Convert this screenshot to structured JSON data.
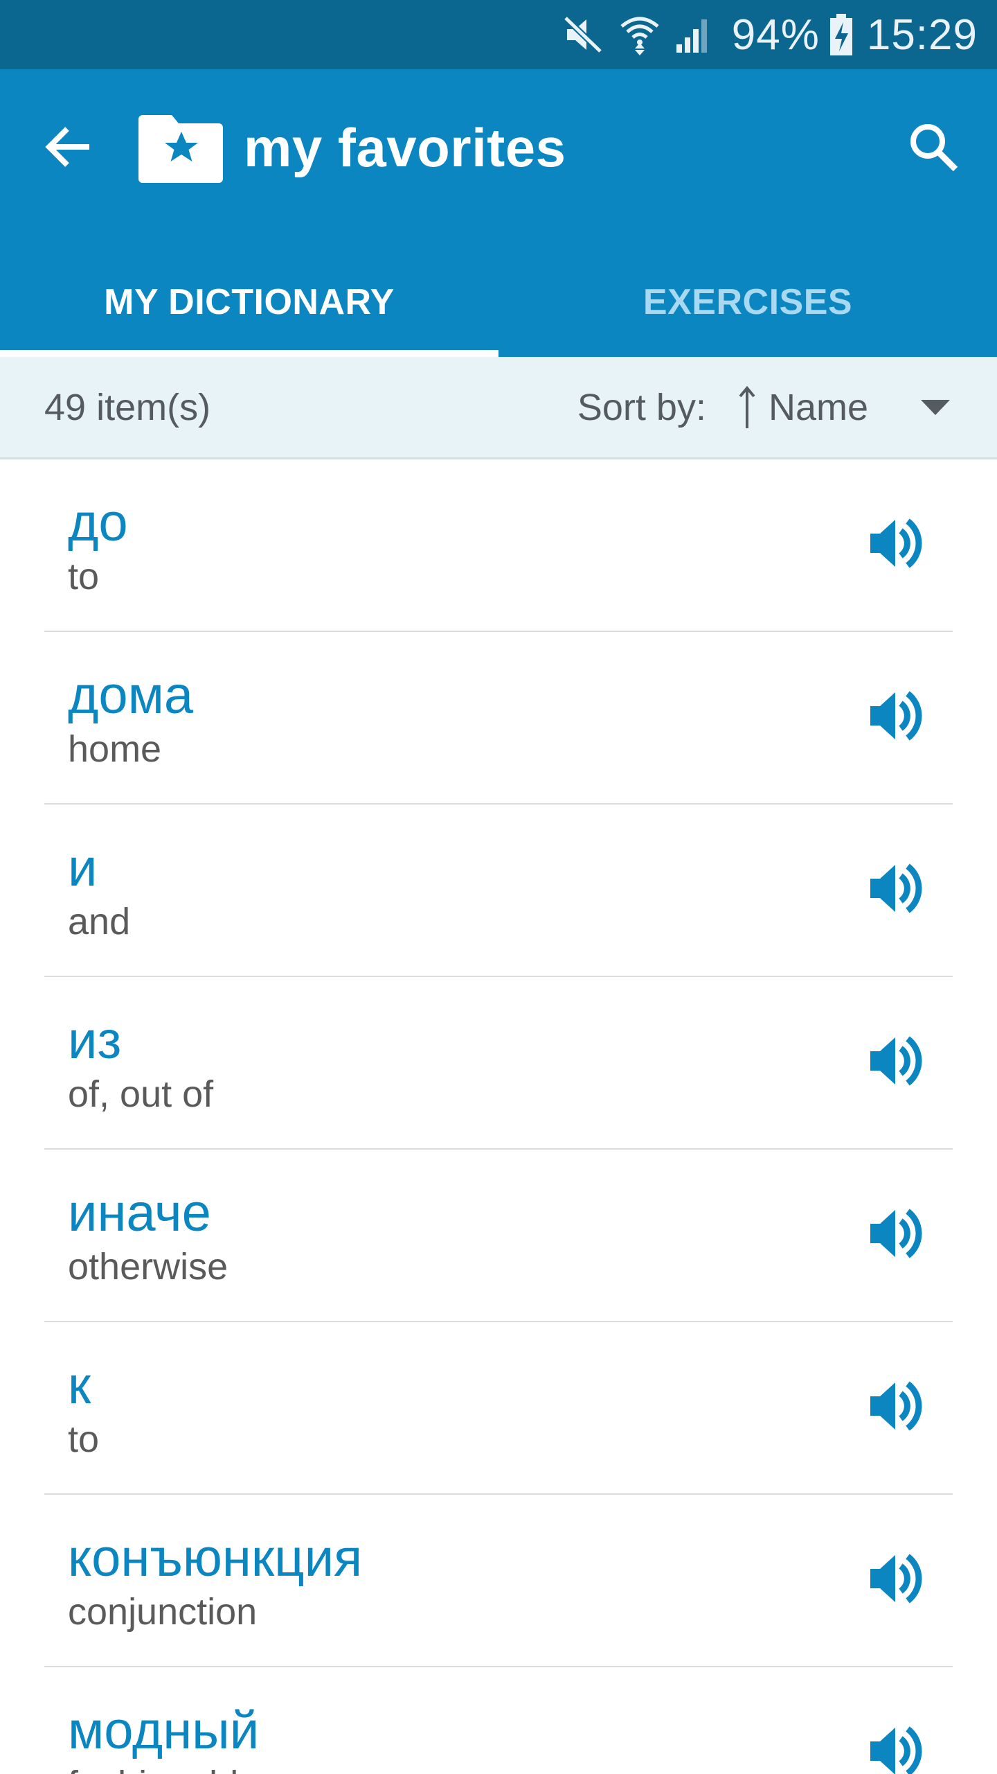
{
  "status_bar": {
    "battery_percent": "94%",
    "time": "15:29",
    "icons": [
      "mute-icon",
      "wifi-icon",
      "signal-icon",
      "battery-charging-icon"
    ]
  },
  "app_bar": {
    "title": "my favorites",
    "back_icon": "arrow-left-icon",
    "title_icon": "folder-star-icon",
    "search_icon": "search-icon",
    "color": "#0b86c1"
  },
  "tabs": [
    {
      "label": "MY DICTIONARY",
      "active": true
    },
    {
      "label": "EXERCISES",
      "active": false
    }
  ],
  "sort_bar": {
    "count": "49 item(s)",
    "sort_label": "Sort by:",
    "sort_value": "Name",
    "sort_direction_icon": "sort-ascending-icon",
    "dropdown_icon": "caret-down-icon"
  },
  "items": [
    {
      "word": "до",
      "meaning": "to"
    },
    {
      "word": "дома",
      "meaning": "home"
    },
    {
      "word": "и",
      "meaning": "and"
    },
    {
      "word": "из",
      "meaning": "of, out of"
    },
    {
      "word": "иначе",
      "meaning": "otherwise"
    },
    {
      "word": "к",
      "meaning": "to"
    },
    {
      "word": "конъюнкция",
      "meaning": "conjunction"
    },
    {
      "word": "модный",
      "meaning": "fashionable"
    }
  ],
  "colors": {
    "status_bar": "#0b6690",
    "accent": "#0b86c1",
    "sort_bar_bg": "#e8f3f8"
  }
}
